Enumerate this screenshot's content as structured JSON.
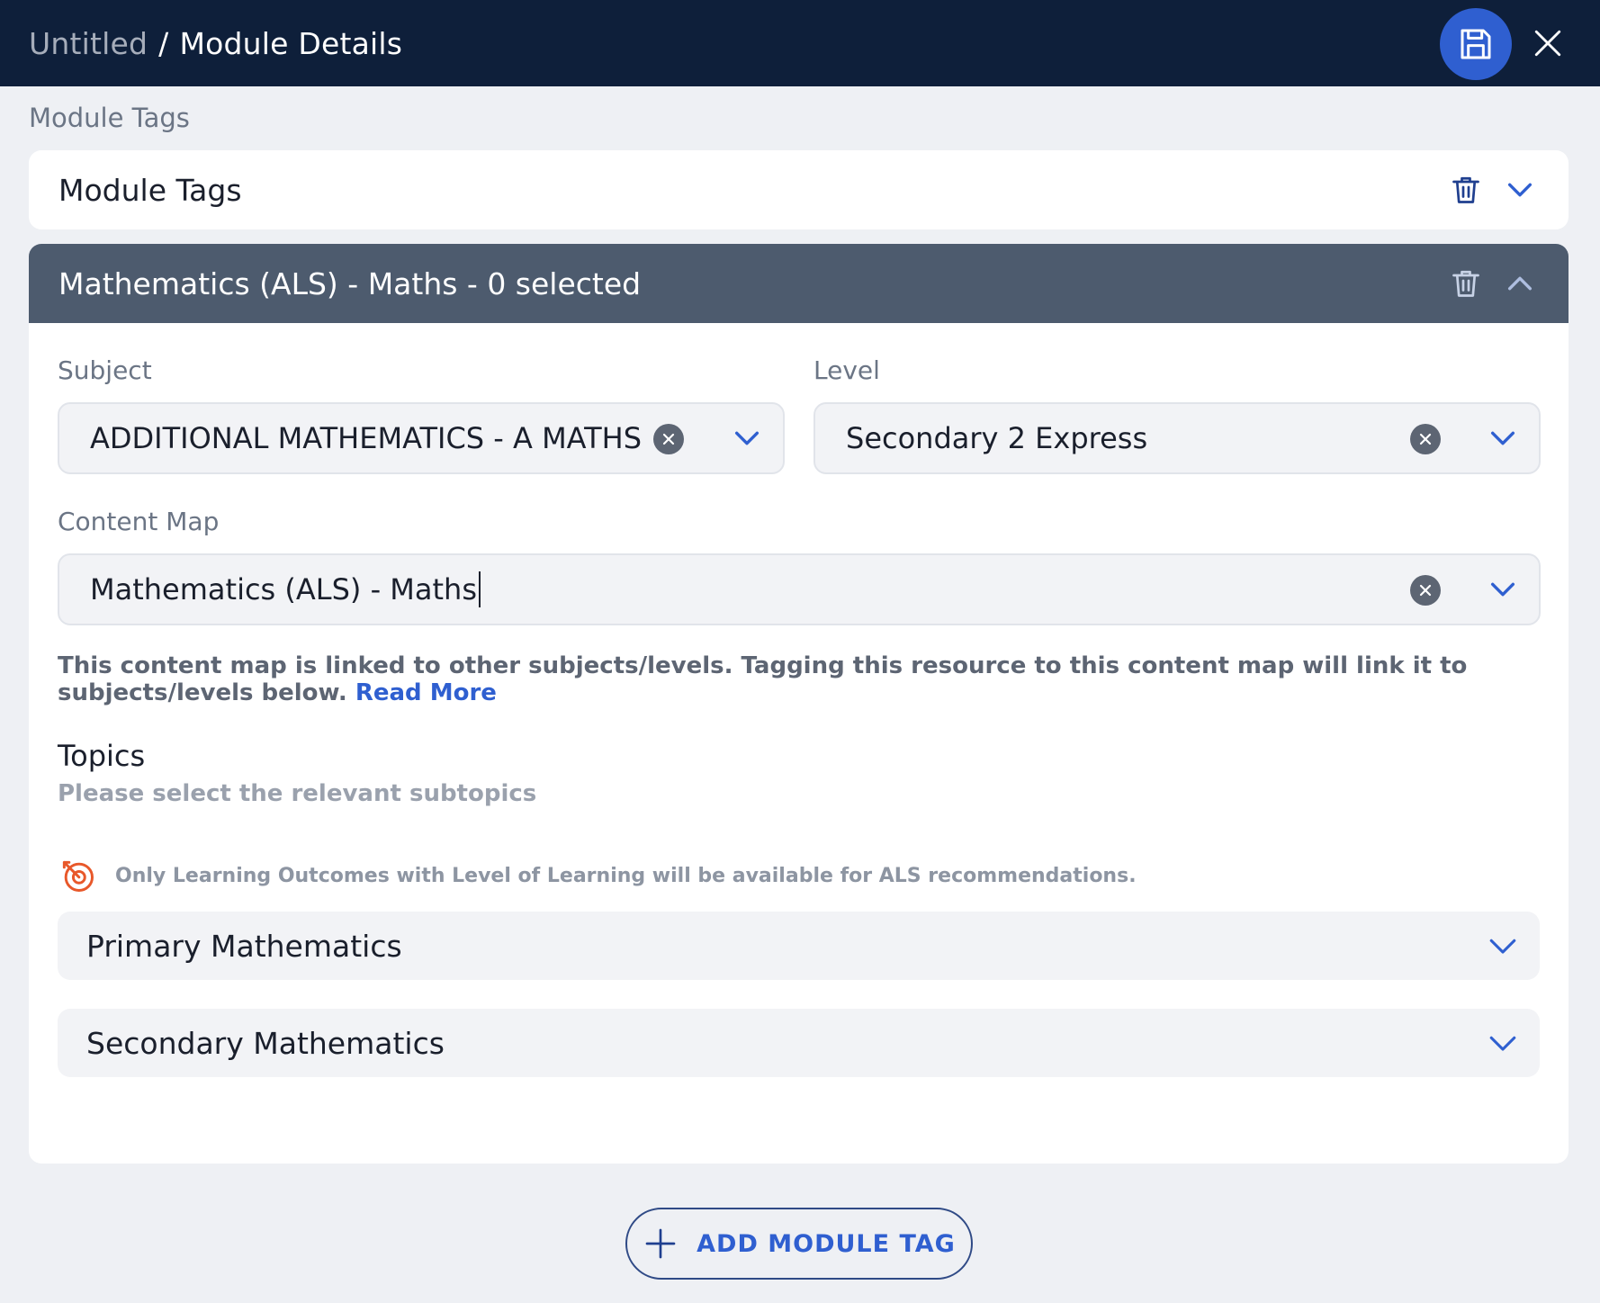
{
  "header": {
    "breadcrumb_root": "Untitled",
    "breadcrumb_separator": "/",
    "breadcrumb_current": "Module Details",
    "save_icon": "floppy-disk-icon",
    "close_icon": "close-icon"
  },
  "section_label": "Module Tags",
  "collapsed_card": {
    "title": "Module Tags",
    "delete_icon": "trash-icon",
    "expand_icon": "chevron-down-icon"
  },
  "expanded_card": {
    "title": "Mathematics (ALS) - Maths - 0 selected",
    "delete_icon": "trash-icon",
    "collapse_icon": "chevron-up-icon",
    "subject": {
      "label": "Subject",
      "value": "ADDITIONAL MATHEMATICS - A MATHS"
    },
    "level": {
      "label": "Level",
      "value": "Secondary 2 Express"
    },
    "content_map": {
      "label": "Content Map",
      "value": "Mathematics (ALS) - Maths"
    },
    "info_text": "This content map is linked to other subjects/levels. Tagging this resource to this content map will link it to subjects/levels below.",
    "read_more": "Read More",
    "topics_title": "Topics",
    "topics_subtitle": "Please select the relevant subtopics",
    "notice_text": "Only Learning Outcomes with Level of Learning will be available for ALS recommendations.",
    "notice_icon": "target-icon",
    "accordions": [
      {
        "label": "Primary Mathematics"
      },
      {
        "label": "Secondary Mathematics"
      }
    ]
  },
  "add_tag_button": {
    "label": "ADD MODULE TAG",
    "icon": "plus-icon"
  },
  "colors": {
    "header_bg": "#0e1f3a",
    "accent": "#2f5fd0",
    "card_head_bg": "#4d5b6e",
    "notice_icon": "#e8582a"
  }
}
